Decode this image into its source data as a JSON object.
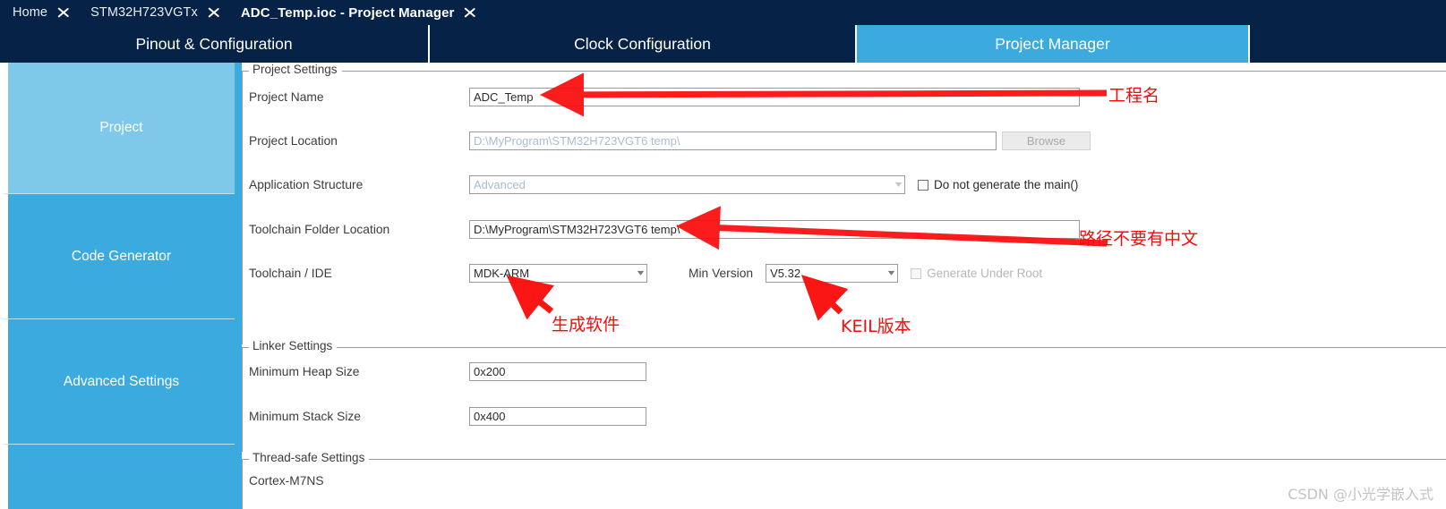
{
  "breadcrumb": {
    "items": [
      {
        "label": "Home",
        "active": false
      },
      {
        "label": "STM32H723VGTx",
        "active": false
      },
      {
        "label": "ADC_Temp.ioc - Project Manager",
        "active": true
      }
    ]
  },
  "tabs": [
    {
      "label": "Pinout & Configuration",
      "selected": false
    },
    {
      "label": "Clock Configuration",
      "selected": false
    },
    {
      "label": "Project Manager",
      "selected": true
    }
  ],
  "sidebar": {
    "items": [
      {
        "label": "Project",
        "selected": true
      },
      {
        "label": "Code Generator",
        "selected": false
      },
      {
        "label": "Advanced Settings",
        "selected": false
      },
      {
        "label": "",
        "selected": false
      }
    ]
  },
  "project_settings": {
    "group_title": "Project Settings",
    "project_name_label": "Project Name",
    "project_name_value": "ADC_Temp",
    "project_location_label": "Project Location",
    "project_location_value": "D:\\MyProgram\\STM32H723VGT6 temp\\",
    "application_structure_label": "Application Structure",
    "application_structure_value": "Advanced",
    "do_not_generate_main_label": "Do not generate the main()",
    "do_not_generate_main_checked": false,
    "toolchain_folder_label": "Toolchain Folder Location",
    "toolchain_folder_value": "D:\\MyProgram\\STM32H723VGT6 temp\\",
    "toolchain_ide_label": "Toolchain / IDE",
    "toolchain_ide_value": "MDK-ARM",
    "min_version_label": "Min Version",
    "min_version_value": "V5.32",
    "generate_under_root_label": "Generate Under Root",
    "generate_under_root_checked": false,
    "browse_label": "Browse"
  },
  "linker_settings": {
    "group_title": "Linker Settings",
    "min_heap_label": "Minimum Heap Size",
    "min_heap_value": "0x200",
    "min_stack_label": "Minimum Stack Size",
    "min_stack_value": "0x400"
  },
  "thread_safe_settings": {
    "group_title": "Thread-safe Settings",
    "core_label": "Cortex-M7NS"
  },
  "annotations": [
    {
      "id": "project-name",
      "text": "工程名"
    },
    {
      "id": "path-no-chinese",
      "text": "路径不要有中文"
    },
    {
      "id": "generation-software",
      "text": "生成软件"
    },
    {
      "id": "keil-version",
      "text": "KEIL版本"
    }
  ],
  "watermark": {
    "text": "CSDN @小光学嵌入式"
  },
  "colors": {
    "navy": "#062247",
    "accent_blue": "#3babdf",
    "selected_sidebar": "#7ec8e9",
    "annotation_red": "#fb0a0a"
  }
}
